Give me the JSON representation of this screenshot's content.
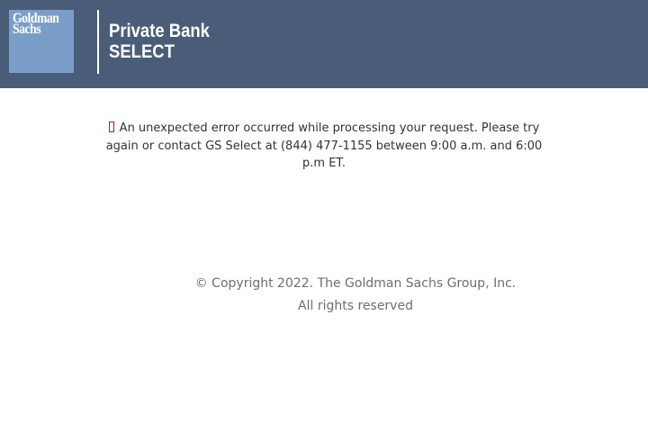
{
  "header": {
    "logo": {
      "line1": "Goldman",
      "line2": "Sachs"
    },
    "brand": {
      "line1": "Private Bank",
      "line2": "SELECT"
    }
  },
  "error": {
    "icon": "error-icon",
    "message": "An unexpected error occurred while processing your request. Please try again or contact GS Select at (844) 477-1155 between 9:00 a.m. and 6:00 p.m ET."
  },
  "footer": {
    "copyright": "© Copyright 2022. The Goldman Sachs Group, Inc.",
    "rights": "All rights reserved"
  },
  "colors": {
    "header_bg": "#4a5d78",
    "logo_bg": "#7b9ec9",
    "error_icon": "#cc1111",
    "footer_text": "#6e6e6e"
  }
}
